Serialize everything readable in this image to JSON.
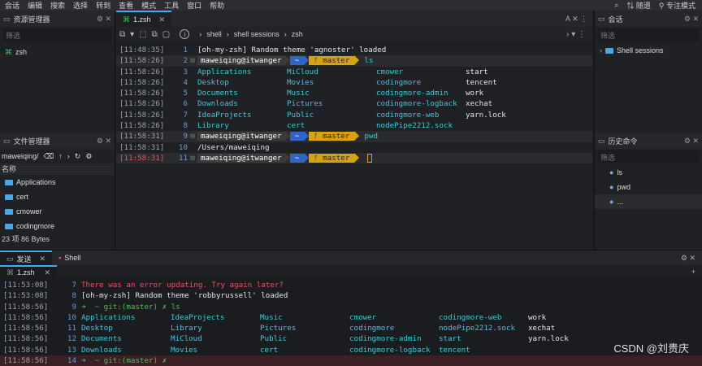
{
  "menu": [
    "会话",
    "编辑",
    "搜索",
    "选择",
    "转到",
    "查看",
    "模式",
    "工具",
    "窗口",
    "帮助"
  ],
  "menu_right": {
    "search_icon": "search-icon",
    "tracking": "随遗",
    "mode": "专注模式"
  },
  "resource_manager": {
    "title": "资源管理器",
    "filter": "筛选",
    "items": [
      {
        "label": "zsh"
      }
    ]
  },
  "file_manager": {
    "title": "文件管理器",
    "path": "maweiqing/",
    "col_name": "名称",
    "items": [
      "Applications",
      "cert",
      "cmower",
      "codingmore"
    ],
    "status": "23 项 86 Bytes"
  },
  "terminal": {
    "tab_label": "1.zsh",
    "breadcrumbs": [
      "shell",
      "shell sessions",
      "zsh"
    ],
    "lines": [
      {
        "ts": "[11:48:35]",
        "ln": "1",
        "text": "[oh-my-zsh] Random theme 'agnoster' loaded"
      },
      {
        "ts": "[11:58:26]",
        "ln": "2",
        "prompt": {
          "user": "maweiqing@itwanger",
          "dir": "~",
          "git": "master"
        },
        "cmd": "ls"
      },
      {
        "ts": "[11:58:26]",
        "ln": "3",
        "cols": [
          "Applications",
          "MiCloud",
          "cmower",
          "start"
        ]
      },
      {
        "ts": "[11:58:26]",
        "ln": "4",
        "cols": [
          "Desktop",
          "Movies",
          "codingmore",
          "tencent"
        ]
      },
      {
        "ts": "[11:58:26]",
        "ln": "5",
        "cols": [
          "Documents",
          "Music",
          "codingmore-admin",
          "work"
        ]
      },
      {
        "ts": "[11:58:26]",
        "ln": "6",
        "cols": [
          "Downloads",
          "Pictures",
          "codingmore-logback",
          "xechat"
        ]
      },
      {
        "ts": "[11:58:26]",
        "ln": "7",
        "cols": [
          "IdeaProjects",
          "Public",
          "codingmore-web",
          "yarn.lock"
        ]
      },
      {
        "ts": "[11:58:26]",
        "ln": "8",
        "cols": [
          "Library",
          "cert",
          "nodePipe2212.sock",
          ""
        ]
      },
      {
        "ts": "[11:58:31]",
        "ln": "9",
        "prompt": {
          "user": "maweiqing@itwanger",
          "dir": "~",
          "git": "master"
        },
        "cmd": "pwd"
      },
      {
        "ts": "[11:58:31]",
        "ln": "10",
        "text": "/Users/maweiqing"
      },
      {
        "ts": "[11:58:31]",
        "ln": "11",
        "prompt": {
          "user": "maweiqing@itwanger",
          "dir": "~",
          "git": "master"
        },
        "cmd": ""
      }
    ]
  },
  "sessions": {
    "title": "会话",
    "filter": "筛选",
    "items": [
      "Shell sessions"
    ]
  },
  "history": {
    "title": "历史命令",
    "filter": "筛选",
    "items": [
      "ls",
      "pwd",
      "..."
    ]
  },
  "bottom": {
    "tabs": [
      "发送",
      "Shell"
    ],
    "sub_tab": "1.zsh",
    "lines": [
      {
        "ts": "[11:53:08]",
        "ln": "7",
        "text": "There was an error updating. Try again later?",
        "color": "#e05561"
      },
      {
        "ts": "[11:53:08]",
        "ln": "8",
        "text": "[oh-my-zsh] Random theme 'robbyrussell' loaded"
      },
      {
        "ts": "[11:58:56]",
        "ln": "9",
        "text": "➜  ~ git:(master) ✗ ls"
      },
      {
        "ts": "[11:58:56]",
        "ln": "10",
        "cols": [
          "Applications",
          "IdeaProjects",
          "Music",
          "cmower",
          "codingmore-web",
          "work"
        ]
      },
      {
        "ts": "[11:58:56]",
        "ln": "11",
        "cols": [
          "Desktop",
          "Library",
          "Pictures",
          "codingmore",
          "nodePipe2212.sock",
          "xechat"
        ]
      },
      {
        "ts": "[11:58:56]",
        "ln": "12",
        "cols": [
          "Documents",
          "MiCloud",
          "Public",
          "codingmore-admin",
          "start",
          "yarn.lock"
        ]
      },
      {
        "ts": "[11:58:56]",
        "ln": "13",
        "cols": [
          "Downloads",
          "Movies",
          "cert",
          "codingmore-logback",
          "tencent",
          ""
        ]
      },
      {
        "ts": "[11:58:56]",
        "ln": "14",
        "text": "➜  ~ git:(master) ✗"
      }
    ]
  },
  "watermark": "CSDN @刘贵庆"
}
